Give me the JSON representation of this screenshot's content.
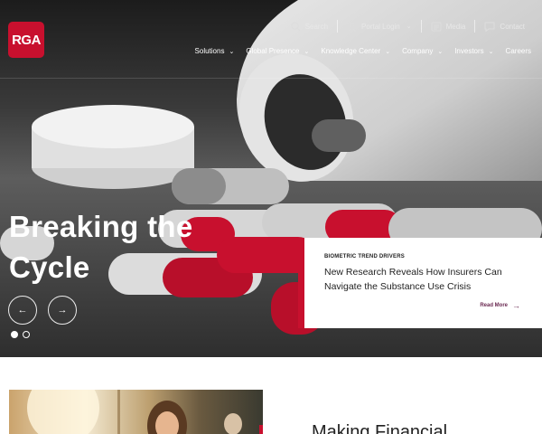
{
  "brand": {
    "logo_text": "RGA",
    "accent": "#c8102e",
    "link_color": "#6b2a52"
  },
  "utility_nav": [
    {
      "label": "Search",
      "icon": "search-icon"
    },
    {
      "label": "Portal Login",
      "icon": "user-icon",
      "dropdown": true
    },
    {
      "label": "Media",
      "icon": "media-icon"
    },
    {
      "label": "Contact",
      "icon": "chat-icon"
    }
  ],
  "main_nav": [
    {
      "label": "Solutions",
      "dropdown": true
    },
    {
      "label": "Global Presence",
      "dropdown": true
    },
    {
      "label": "Knowledge Center",
      "dropdown": true
    },
    {
      "label": "Company",
      "dropdown": true
    },
    {
      "label": "Investors",
      "dropdown": true
    },
    {
      "label": "Careers",
      "dropdown": false
    }
  ],
  "hero": {
    "headline": "Breaking the Cycle",
    "prev_glyph": "←",
    "next_glyph": "→",
    "slides_total": 2,
    "slide_active": 1
  },
  "feature_card": {
    "eyebrow": "BIOMETRIC TREND DRIVERS",
    "title": "New Research Reveals How Insurers Can Navigate the Substance Use Crisis",
    "read_more": "Read More",
    "read_more_glyph": "→"
  },
  "section": {
    "title": "Making Financial"
  }
}
